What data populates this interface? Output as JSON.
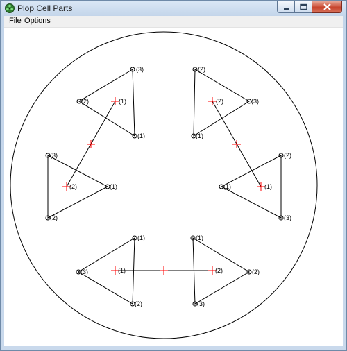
{
  "window": {
    "title": "Plop Cell Parts",
    "icon": "green-cell-icon"
  },
  "caption_buttons": {
    "minimize": "minimize-icon",
    "maximize": "maximize-icon",
    "close": "close-icon"
  },
  "menu": {
    "items": [
      {
        "label": "File",
        "accel": "F"
      },
      {
        "label": "Options",
        "accel": "O"
      }
    ]
  },
  "drawing": {
    "colors": {
      "lines": "#000000",
      "markers": "#ff0000",
      "background": "#ffffff"
    },
    "labels": {
      "tl_a": "(3)",
      "tl_b": "(2)",
      "tl_c": "(1)",
      "tl_d": "(1)",
      "tr_a": "(2)",
      "tr_b": "(2)",
      "tr_c": "(3)",
      "tr_d": "(1)",
      "ml_a": "(3)",
      "ml_b": "(2)",
      "ml_c": "(1)",
      "ml_d": "(2)",
      "mr_a": "(2)",
      "mr_b": "(1)",
      "mr_c": "(1)",
      "mr_d": "(3)",
      "bl_a": "(1)",
      "bl_b": "(3)",
      "bl_c": "(1)",
      "bl_d": "(2)",
      "br_a": "(1)",
      "br_b": "(2)",
      "br_c": "(2)",
      "br_d": "(3)"
    }
  }
}
